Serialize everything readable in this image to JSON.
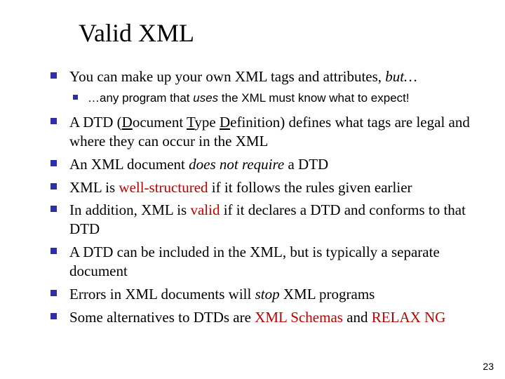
{
  "title": "Valid XML",
  "page_number": "23",
  "bullets": {
    "b1_pre": "You can make up your own XML tags and attributes, ",
    "b1_but": "but…",
    "sub1_pre": "…any program that ",
    "sub1_uses": "uses",
    "sub1_post": " the XML must know what to expect!",
    "b2_pre": "A DTD (",
    "b2_d": "D",
    "b2_mid1": "ocument ",
    "b2_t": "T",
    "b2_mid2": "ype ",
    "b2_def": "D",
    "b2_mid3": "efinition) defines what tags are legal and where they can occur in the XML",
    "b3_pre": "An XML document ",
    "b3_em": "does not require",
    "b3_post": " a DTD",
    "b4_pre": "XML is ",
    "b4_red": "well-structured",
    "b4_post": " if it follows the rules given earlier",
    "b5_pre": "In addition, XML is ",
    "b5_red": "valid",
    "b5_post": " if it declares a DTD and conforms to that DTD",
    "b6": "A DTD can be included in the XML, but is typically a separate document",
    "b7_pre": "Errors in XML documents will ",
    "b7_em": "stop",
    "b7_post": " XML programs",
    "b8_pre": "Some alternatives to DTDs are ",
    "b8_red1": "XML Schemas",
    "b8_mid": " and ",
    "b8_red2": "RELAX NG"
  }
}
